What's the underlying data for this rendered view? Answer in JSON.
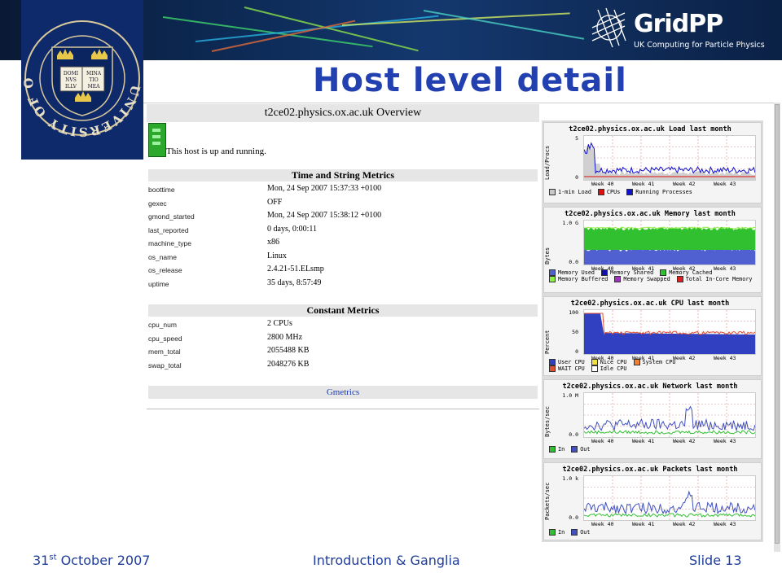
{
  "slide": {
    "title": "Host level detail",
    "footer_left_day": "31",
    "footer_left_suffix": "st",
    "footer_left_rest": " October 2007",
    "footer_center": "Introduction & Ganglia",
    "footer_right": "Slide 13"
  },
  "logos": {
    "oxford": {
      "motto_left": "DOMI\nNVS\nILLV",
      "motto_right": "MINA\nTIO\nMEA",
      "ring_text": "UNIVERSITY OF OXFORD"
    },
    "gridpp": {
      "name": "GridPP",
      "tagline": "UK Computing for Particle Physics"
    }
  },
  "overview": {
    "header": "t2ce02.physics.ox.ac.uk Overview",
    "status": "This host is up and running.",
    "time_string_title": "Time and String Metrics",
    "time_string": [
      {
        "k": "boottime",
        "v": "Mon, 24 Sep 2007 15:37:33 +0100"
      },
      {
        "k": "gexec",
        "v": "OFF"
      },
      {
        "k": "gmond_started",
        "v": "Mon, 24 Sep 2007 15:38:12 +0100"
      },
      {
        "k": "last_reported",
        "v": "0 days, 0:00:11"
      },
      {
        "k": "machine_type",
        "v": "x86"
      },
      {
        "k": "os_name",
        "v": "Linux"
      },
      {
        "k": "os_release",
        "v": "2.4.21-51.ELsmp"
      },
      {
        "k": "uptime",
        "v": "35 days, 8:57:49"
      }
    ],
    "constant_title": "Constant Metrics",
    "constant": [
      {
        "k": "cpu_num",
        "v": "2 CPUs"
      },
      {
        "k": "cpu_speed",
        "v": "2800 MHz"
      },
      {
        "k": "mem_total",
        "v": "2055488 KB"
      },
      {
        "k": "swap_total",
        "v": "2048276 KB"
      }
    ],
    "gmetrics_link": "Gmetrics"
  },
  "graphs": [
    {
      "title": "t2ce02.physics.ox.ac.uk Load last month",
      "ylabel": "Load/Procs",
      "yticks": [
        "5",
        "0"
      ],
      "xticks": [
        "Week 40",
        "Week 41",
        "Week 42",
        "Week 43"
      ],
      "legend": [
        {
          "label": "1-min Load",
          "color": "#c8c8c8"
        },
        {
          "label": "CPUs",
          "color": "#e01010"
        },
        {
          "label": "Running Processes",
          "color": "#1010d0"
        }
      ]
    },
    {
      "title": "t2ce02.physics.ox.ac.uk Memory last month",
      "ylabel": "Bytes",
      "yticks": [
        "1.0 G",
        "0.0"
      ],
      "xticks": [
        "Week 40",
        "Week 41",
        "Week 42",
        "Week 43"
      ],
      "legend": [
        {
          "label": "Memory Used",
          "color": "#5060d0"
        },
        {
          "label": "Memory Shared",
          "color": "#1010b0"
        },
        {
          "label": "Memory Cached",
          "color": "#30c030"
        },
        {
          "label": "Memory Buffered",
          "color": "#90f040"
        },
        {
          "label": "Memory Swapped",
          "color": "#a030c0"
        },
        {
          "label": "Total In-Core Memory",
          "color": "#e02020"
        }
      ]
    },
    {
      "title": "t2ce02.physics.ox.ac.uk CPU last month",
      "ylabel": "Percent",
      "yticks": [
        "100",
        "50",
        "0"
      ],
      "xticks": [
        "Week 40",
        "Week 41",
        "Week 42",
        "Week 43"
      ],
      "legend": [
        {
          "label": "User CPU",
          "color": "#3040c0"
        },
        {
          "label": "Nice CPU",
          "color": "#f0e040"
        },
        {
          "label": "System CPU",
          "color": "#f08030"
        },
        {
          "label": "WAIT CPU",
          "color": "#e05030"
        },
        {
          "label": "Idle CPU",
          "color": "#ffffff"
        }
      ]
    },
    {
      "title": "t2ce02.physics.ox.ac.uk Network last month",
      "ylabel": "Bytes/sec",
      "yticks": [
        "1.0 M",
        "0.0"
      ],
      "xticks": [
        "Week 40",
        "Week 41",
        "Week 42",
        "Week 43"
      ],
      "legend": [
        {
          "label": "In",
          "color": "#30c030"
        },
        {
          "label": "Out",
          "color": "#4050c0"
        }
      ]
    },
    {
      "title": "t2ce02.physics.ox.ac.uk Packets last month",
      "ylabel": "Packets/sec",
      "yticks": [
        "1.0 k",
        "0.0"
      ],
      "xticks": [
        "Week 40",
        "Week 41",
        "Week 42",
        "Week 43"
      ],
      "legend": [
        {
          "label": "In",
          "color": "#30c030"
        },
        {
          "label": "Out",
          "color": "#4050c0"
        }
      ]
    }
  ],
  "colors": {
    "title_blue": "#2340b0",
    "footer_blue": "#1e3c9a",
    "banner": "#0d2a55"
  }
}
